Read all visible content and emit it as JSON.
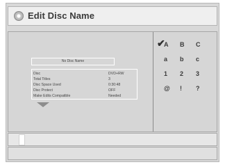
{
  "header": {
    "title": "Edit Disc Name",
    "icon": "disc-icon"
  },
  "disc_name": "No Disc Name",
  "info": [
    {
      "label": "Disc",
      "value": "DVD+RW"
    },
    {
      "label": "Total Titles",
      "value": "3"
    },
    {
      "label": "Disc Space Used",
      "value": "0:30:48"
    },
    {
      "label": "Disc Protect",
      "value": "OFF"
    },
    {
      "label": "Make Edits Compatible",
      "value": "Needed"
    }
  ],
  "char_pad": {
    "selected_row": 0,
    "rows": [
      [
        "A",
        "B",
        "C"
      ],
      [
        "a",
        "b",
        "c"
      ],
      [
        "1",
        "2",
        "3"
      ],
      [
        "@",
        "!",
        "?"
      ]
    ]
  },
  "input": {
    "value": ""
  },
  "colors": {
    "panel": "#d6d6d6",
    "border": "#a6a6a6",
    "text": "#3a3a3a"
  }
}
